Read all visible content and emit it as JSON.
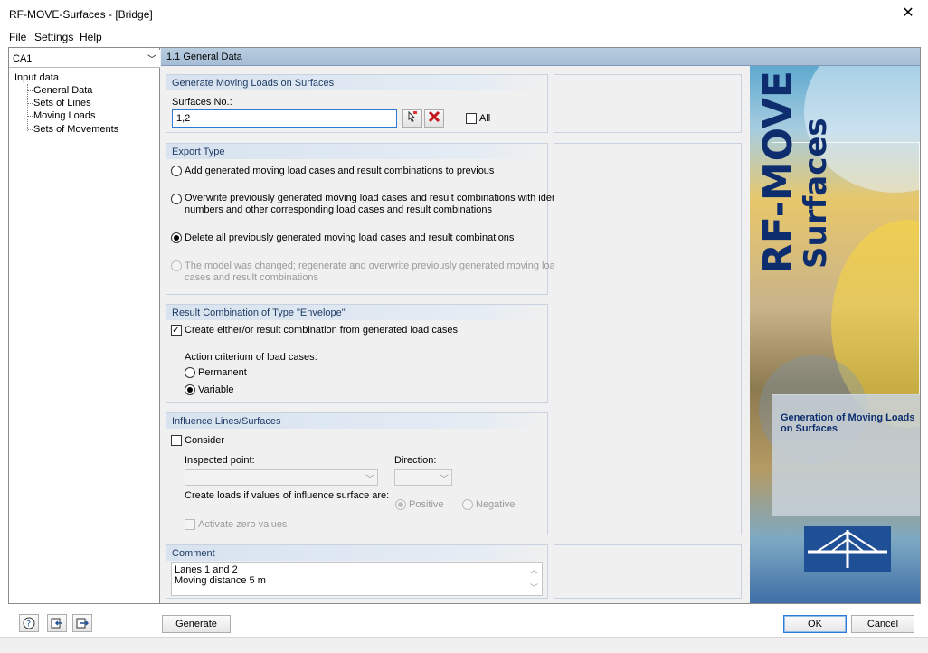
{
  "window": {
    "title": "RF-MOVE-Surfaces - [Bridge]",
    "close_glyph": "✕"
  },
  "menu": [
    "File",
    "Settings",
    "Help"
  ],
  "navigator": {
    "case_select": "CA1",
    "root": "Input data",
    "items": [
      "General Data",
      "Sets of Lines",
      "Moving Loads",
      "Sets of Movements"
    ]
  },
  "main": {
    "header": "1.1 General Data"
  },
  "generate_group": {
    "title": "Generate Moving Loads on Surfaces",
    "surfaces_label": "Surfaces No.:",
    "surfaces_value": "1,2",
    "all_label": "All",
    "pick_icon": "pick-surface-icon",
    "delete_icon": "delete-icon"
  },
  "export_group": {
    "title": "Export Type",
    "options": [
      "Add generated moving load cases and result combinations to previous",
      "Overwrite previously generated moving load cases and result combinations with identical",
      "numbers and other corresponding load cases and result combinations",
      "Delete all previously generated moving load cases and result combinations",
      "The model was changed; regenerate and overwrite previously generated moving load",
      "cases and result combinations"
    ],
    "selected_index": 2
  },
  "envelope_group": {
    "title": "Result Combination of Type \"Envelope\"",
    "create_label": "Create either/or result combination from generated load cases",
    "criterion_label": "Action criterium of load cases:",
    "permanent_label": "Permanent",
    "variable_label": "Variable"
  },
  "influence_group": {
    "title": "Influence Lines/Surfaces",
    "consider_label": "Consider",
    "inspected_label": "Inspected point:",
    "direction_label": "Direction:",
    "create_loads_label": "Create loads if values of influence surface are:",
    "positive_label": "Positive",
    "negative_label": "Negative",
    "zero_label": "Activate zero values"
  },
  "comment_group": {
    "title": "Comment",
    "line1": "Lanes 1 and 2",
    "line2": "Moving distance 5 m"
  },
  "banner": {
    "line1": "RF-MOVE",
    "line2": "Surfaces",
    "description": "Generation of Moving Loads on Surfaces"
  },
  "footer": {
    "generate_label": "Generate",
    "ok_label": "OK",
    "cancel_label": "Cancel"
  },
  "colors": {
    "header_blue": "#b9cde0",
    "group_title": "#1f3c66",
    "banner_text": "#0d2d6e",
    "focus_blue": "#2f7ad6"
  }
}
